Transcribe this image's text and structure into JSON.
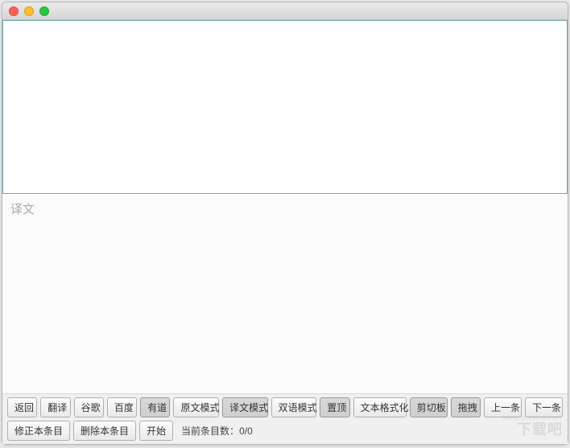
{
  "window": {
    "title": ""
  },
  "source": {
    "value": "",
    "placeholder": ""
  },
  "translation": {
    "placeholder": "译文",
    "value": ""
  },
  "toolbar": {
    "row1": {
      "back": "返回",
      "translate": "翻译",
      "google": "谷歌",
      "baidu": "百度",
      "youdao": "有道",
      "source_mode": "原文模式",
      "translation_mode": "译文模式",
      "bilingual_mode": "双语模式",
      "pin_top": "置顶",
      "text_format": "文本格式化",
      "clipboard": "剪切板",
      "drag": "拖拽",
      "prev": "上一条",
      "next": "下一条"
    },
    "row2": {
      "fix_entry": "修正本条目",
      "delete_entry": "删除本条目",
      "start": "开始"
    }
  },
  "status": {
    "current_count_label": "当前条目数：",
    "current_count_value": "0/0"
  },
  "watermark": {
    "text": "下载吧",
    "sub": "www.xinzaiba.com"
  }
}
